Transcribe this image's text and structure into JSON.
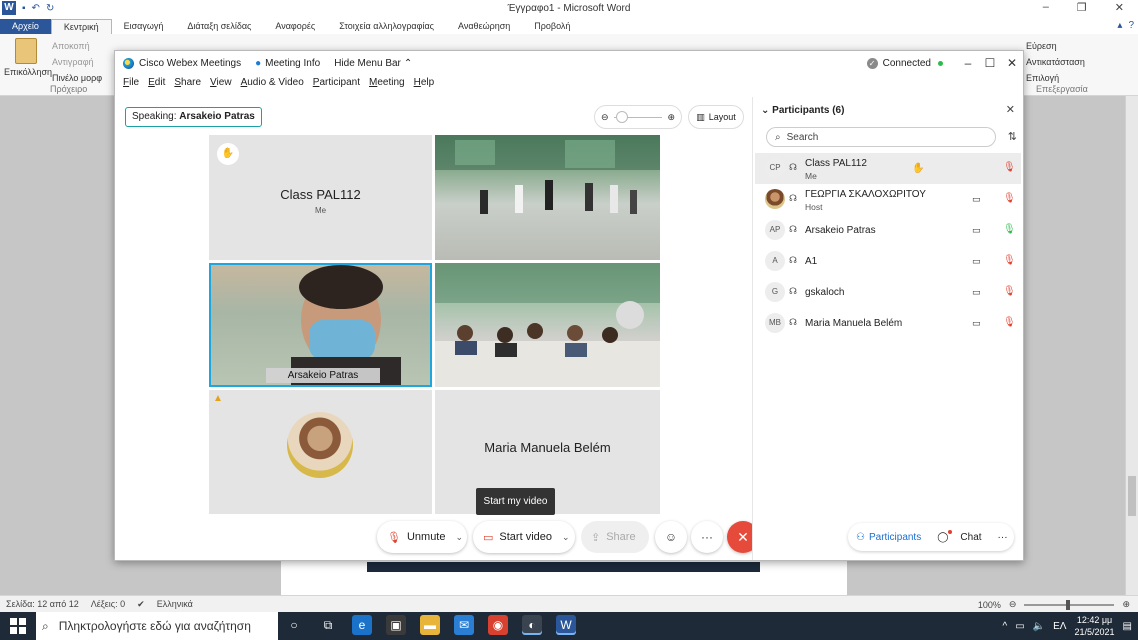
{
  "word": {
    "title": "Έγγραφο1  -  Microsoft Word",
    "tabs": [
      "Αρχείο",
      "Κεντρική",
      "Εισαγωγή",
      "Διάταξη σελίδας",
      "Αναφορές",
      "Στοιχεία αλληλογραφίας",
      "Αναθεώρηση",
      "Προβολή"
    ],
    "ribbon": {
      "paste": "Επικόλληση",
      "clipboard_items": [
        "Αποκοπή",
        "Αντιγραφή",
        "Πινέλο μορφ"
      ],
      "clipboard_group": "Πρόχειρο",
      "editing_items": [
        "Εύρεση",
        "Αντικατάσταση",
        "Επιλογή"
      ],
      "editing_group": "Επεξεργασία"
    },
    "status": {
      "page": "Σελίδα: 12 από 12",
      "words": "Λέξεις: 0",
      "language": "Ελληνικά",
      "zoom": "100%"
    }
  },
  "taskbar": {
    "search_placeholder": "Πληκτρολογήστε εδώ για αναζήτηση",
    "language": "ΕΛ",
    "time": "12:42 μμ",
    "date": "21/5/2021"
  },
  "webex": {
    "app_name": "Cisco Webex Meetings",
    "meeting_info": "Meeting Info",
    "hide_menu": "Hide Menu Bar",
    "status": "Connected",
    "menu": [
      "File",
      "Edit",
      "Share",
      "View",
      "Audio & Video",
      "Participant",
      "Meeting",
      "Help"
    ],
    "speaking_label": "Speaking:",
    "speaking_name": "Arsakeio Patras",
    "layout": "Layout",
    "tiles": {
      "class_name": "Class PAL112",
      "class_sub": "Me",
      "arsakeio": "Arsakeio Patras",
      "maria": "Maria Manuela Belém"
    },
    "tooltip": "Start my video",
    "controls": {
      "unmute": "Unmute",
      "start_video": "Start video",
      "share": "Share"
    },
    "panel": {
      "title": "Participants (6)",
      "search_placeholder": "Search",
      "participants": [
        {
          "initials": "CP",
          "name": "Class PAL112",
          "sub": "Me"
        },
        {
          "initials": "",
          "name": "ΓΕΩΡΓΙΑ ΣΚΑΛΟΧΩΡΙΤΟΥ",
          "sub": "Host"
        },
        {
          "initials": "AP",
          "name": "Arsakeio Patras",
          "sub": ""
        },
        {
          "initials": "A",
          "name": "A1",
          "sub": ""
        },
        {
          "initials": "G",
          "name": "gskaloch",
          "sub": ""
        },
        {
          "initials": "MB",
          "name": "Maria Manuela Belém",
          "sub": ""
        }
      ],
      "tab_participants": "Participants",
      "tab_chat": "Chat"
    }
  }
}
